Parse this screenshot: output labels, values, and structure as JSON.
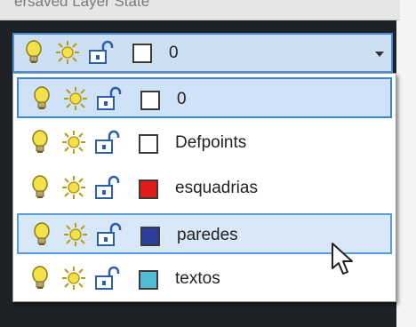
{
  "header": {
    "partial_text": "ersaved Layer State"
  },
  "combo": {
    "selected_layer": {
      "name": "0",
      "color": "#ffffff"
    }
  },
  "layers": [
    {
      "name": "0",
      "color": "#ffffff",
      "state": "selected"
    },
    {
      "name": "Defpoints",
      "color": "#ffffff",
      "state": "normal"
    },
    {
      "name": "esquadrias",
      "color": "#e01b1b",
      "state": "normal"
    },
    {
      "name": "paredes",
      "color": "#2b3d9c",
      "state": "hover"
    },
    {
      "name": "textos",
      "color": "#52bcd2",
      "state": "normal"
    }
  ],
  "icons": {
    "on": "lightbulb-icon",
    "thaw": "sun-icon",
    "lock": "unlock-icon"
  },
  "accent_color": "#3d86d6"
}
